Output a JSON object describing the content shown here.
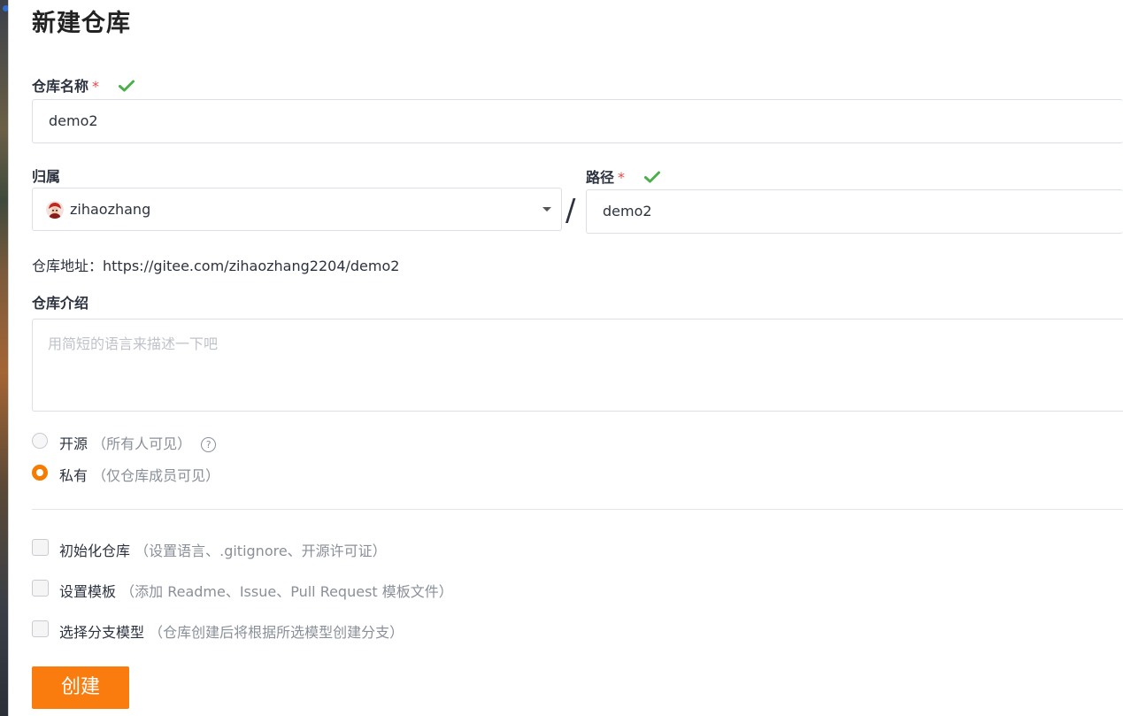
{
  "page_title": "新建仓库",
  "repo_name": {
    "label": "仓库名称",
    "required_mark": "*",
    "value": "demo2"
  },
  "owner": {
    "label": "归属",
    "value": "zihaozhang"
  },
  "path": {
    "label": "路径",
    "required_mark": "*",
    "separator": "/",
    "value": "demo2"
  },
  "address": {
    "text": "仓库地址：https://gitee.com/zihaozhang2204/demo2"
  },
  "description": {
    "label": "仓库介绍",
    "placeholder": "用简短的语言来描述一下吧"
  },
  "visibility": {
    "options": [
      {
        "label": "开源",
        "hint": "（所有人可见）",
        "checked": false
      },
      {
        "label": "私有",
        "hint": "（仅仓库成员可见）",
        "checked": true
      }
    ],
    "help_icon": "question-circle-icon"
  },
  "extras": [
    {
      "label": "初始化仓库",
      "hint": "（设置语言、.gitignore、开源许可证）",
      "checked": false
    },
    {
      "label": "设置模板",
      "hint": "（添加 Readme、Issue、Pull Request 模板文件）",
      "checked": false
    },
    {
      "label": "选择分支模型",
      "hint": "（仓库创建后将根据所选模型创建分支）",
      "checked": false
    }
  ],
  "submit": {
    "label": "创建"
  },
  "colors": {
    "accent": "#fa7c0f",
    "valid": "#4cae4c",
    "required": "#e54848"
  }
}
